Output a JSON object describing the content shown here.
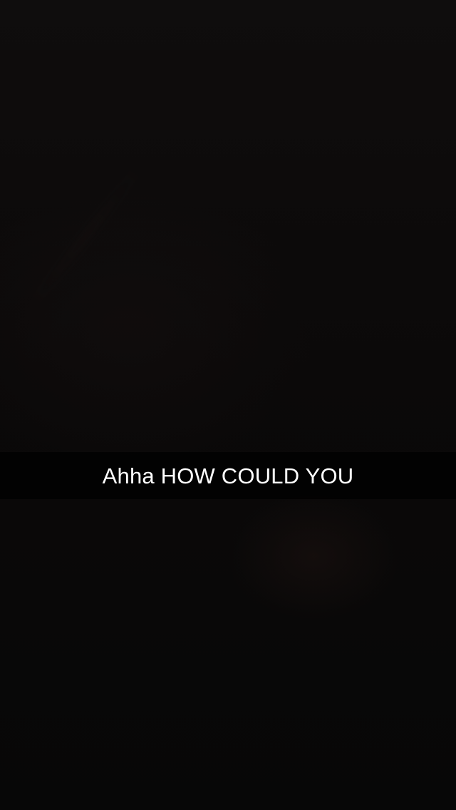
{
  "snap": {
    "caption": "Ahha HOW COULD YOU"
  }
}
